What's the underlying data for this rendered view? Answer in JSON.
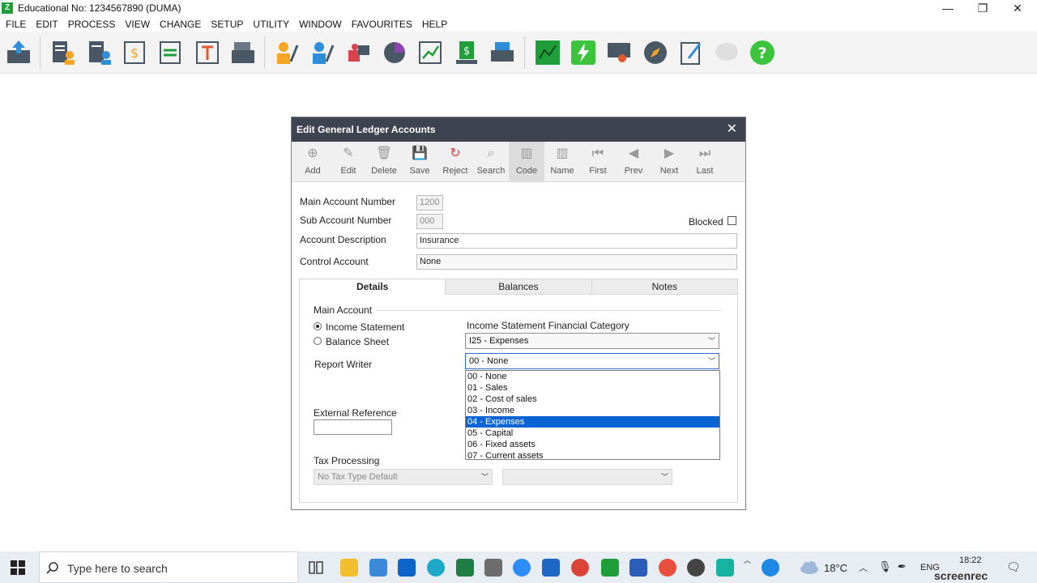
{
  "window": {
    "logo": "Z",
    "title": "Educational No: 1234567890 (DUMA)",
    "minimize": "—",
    "restore": "❐",
    "close": "✕"
  },
  "menu": [
    "FILE",
    "EDIT",
    "PROCESS",
    "VIEW",
    "CHANGE",
    "SETUP",
    "UTILITY",
    "WINDOW",
    "FAVOURITES",
    "HELP"
  ],
  "toolbar_icons": [
    "export-icon",
    "customer-icon",
    "supplier-icon",
    "cashbook-icon",
    "bank-icon",
    "text-icon",
    "pos-icon",
    "user-icon",
    "edit-user-icon",
    "inventory-icon",
    "pie-chart-icon",
    "graph-icon",
    "money-icon",
    "printer-icon",
    "report-icon",
    "lightning-icon",
    "certificate-icon",
    "compass-icon",
    "notes-icon",
    "chat-icon",
    "help-icon"
  ],
  "dialog": {
    "title": "Edit General Ledger Accounts",
    "close": "✕",
    "toolbar": [
      {
        "label": "Add",
        "icon": "⊕"
      },
      {
        "label": "Edit",
        "icon": "✎"
      },
      {
        "label": "Delete",
        "icon": "🗑"
      },
      {
        "label": "Save",
        "icon": "💾"
      },
      {
        "label": "Reject",
        "icon": "↻"
      },
      {
        "label": "Search",
        "icon": "⌕"
      },
      {
        "label": "Code",
        "icon": "▥"
      },
      {
        "label": "Name",
        "icon": "▥"
      },
      {
        "label": "First",
        "icon": "⏮"
      },
      {
        "label": "Prev",
        "icon": "◀"
      },
      {
        "label": "Next",
        "icon": "▶"
      },
      {
        "label": "Last",
        "icon": "⏭"
      }
    ],
    "fields": {
      "main_account_label": "Main Account Number",
      "main_account_value": "1200",
      "sub_account_label": "Sub Account Number",
      "sub_account_value": "000",
      "blocked_label": "Blocked",
      "description_label": "Account Description",
      "description_value": "Insurance",
      "control_label": "Control Account",
      "control_value": "None"
    },
    "tabs": [
      "Details",
      "Balances",
      "Notes"
    ],
    "details": {
      "main_account_group": "Main Account",
      "radio_income": "Income Statement",
      "radio_balance": "Balance Sheet",
      "category_label": "Income Statement Financial Category",
      "category_value": "I25 - Expenses",
      "report_writer_label": "Report Writer",
      "report_writer_value": "00 - None",
      "report_writer_options": [
        "00 - None",
        "01 - Sales",
        "02 - Cost of sales",
        "03 - Income",
        "04 - Expenses",
        "05 - Capital",
        "06 - Fixed assets",
        "07 - Current assets"
      ],
      "highlighted_option": "04 - Expenses",
      "external_ref_label": "External Reference",
      "external_ref_value": "",
      "tax_label": "Tax Processing",
      "tax_value": "No Tax Type Default",
      "tax_second_value": ""
    }
  },
  "taskbar": {
    "search_placeholder": "Type here to search",
    "weather": "18°C",
    "language": "ENG",
    "time": "18:22",
    "watermark": "screenrec"
  }
}
